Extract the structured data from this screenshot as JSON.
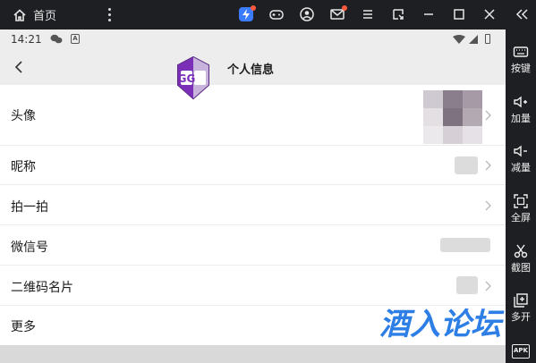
{
  "emulator": {
    "home_label": "首页",
    "colors": {
      "bar_bg": "#1e1f23",
      "accent_blue": "#3b7cff",
      "red_dot": "#ff5a3c"
    }
  },
  "sidebar": {
    "items": [
      {
        "label": "按键",
        "icon": "keyboard-icon"
      },
      {
        "label": "加量",
        "icon": "volume-up-icon"
      },
      {
        "label": "减量",
        "icon": "volume-down-icon"
      },
      {
        "label": "全屏",
        "icon": "fullscreen-icon"
      },
      {
        "label": "截图",
        "icon": "scissors-icon"
      },
      {
        "label": "多开",
        "icon": "multi-open-icon"
      }
    ],
    "apk_label": "APK"
  },
  "status_bar": {
    "time": "14:21"
  },
  "page": {
    "title": "个人信息"
  },
  "rows": [
    {
      "label": "头像"
    },
    {
      "label": "昵称"
    },
    {
      "label": "拍一拍"
    },
    {
      "label": "微信号"
    },
    {
      "label": "二维码名片"
    },
    {
      "label": "更多"
    }
  ],
  "watermark": {
    "text": "酒入论坛"
  },
  "logo": {
    "text": "GG"
  }
}
